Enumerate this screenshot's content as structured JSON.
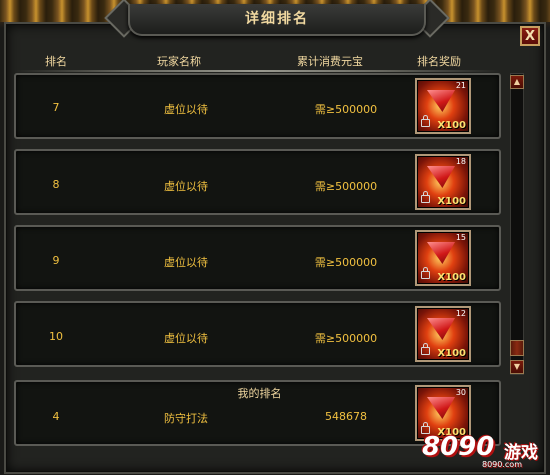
{
  "window": {
    "title": "详细排名",
    "close_label": "X"
  },
  "columns": {
    "rank": "排名",
    "player": "玩家名称",
    "spent": "累计消费元宝",
    "reward": "排名奖励"
  },
  "rows": [
    {
      "rank": "7",
      "player": "虚位以待",
      "spent": "需≥500000",
      "reward_count": "21",
      "reward_qty": "X100"
    },
    {
      "rank": "8",
      "player": "虚位以待",
      "spent": "需≥500000",
      "reward_count": "18",
      "reward_qty": "X100"
    },
    {
      "rank": "9",
      "player": "虚位以待",
      "spent": "需≥500000",
      "reward_count": "15",
      "reward_qty": "X100"
    },
    {
      "rank": "10",
      "player": "虚位以待",
      "spent": "需≥500000",
      "reward_count": "12",
      "reward_qty": "X100"
    }
  ],
  "my_rank": {
    "title": "我的排名",
    "rank": "4",
    "player": "防守打法",
    "spent": "548678",
    "reward_count": "30",
    "reward_qty": "X100"
  },
  "scrollbar": {
    "up_icon": "triangle-up",
    "down_icon": "triangle-down"
  },
  "watermark": {
    "number": "8090",
    "text": "游戏",
    "url": "8090.com"
  },
  "colors": {
    "accent_text": "#f0c040",
    "header_text": "#f0d7a0",
    "background": "#1a1a18"
  }
}
